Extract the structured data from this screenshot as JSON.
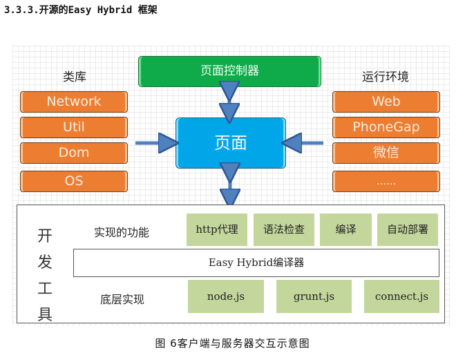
{
  "heading": "3.3.3.开源的Easy Hybrid 框架",
  "diagram": {
    "libraries": {
      "title": "类库",
      "items": [
        "Network",
        "Util",
        "Dom",
        "OS"
      ]
    },
    "runtime": {
      "title": "运行环境",
      "items": [
        "Web",
        "PhoneGap",
        "微信",
        "......"
      ]
    },
    "page_controller": "页面控制器",
    "page": "页面",
    "dev_tools": {
      "title_chars": [
        "开",
        "发",
        "工",
        "具"
      ],
      "features_label": "实现的功能",
      "features": [
        "http代理",
        "语法检查",
        "编译",
        "自动部署"
      ],
      "compiler": "Easy Hybrid编译器",
      "underlying_label": "底层实现",
      "underlying": [
        "node.js",
        "grunt.js",
        "connect.js"
      ]
    },
    "colors": {
      "library_box": "#ed7d31",
      "controller_box": "#0faa4a",
      "page_box": "#00a6e8",
      "tool_box": "#c3d69b",
      "arrow": "#4f81bd"
    }
  },
  "caption": "图 6客户端与服务器交互示意图"
}
